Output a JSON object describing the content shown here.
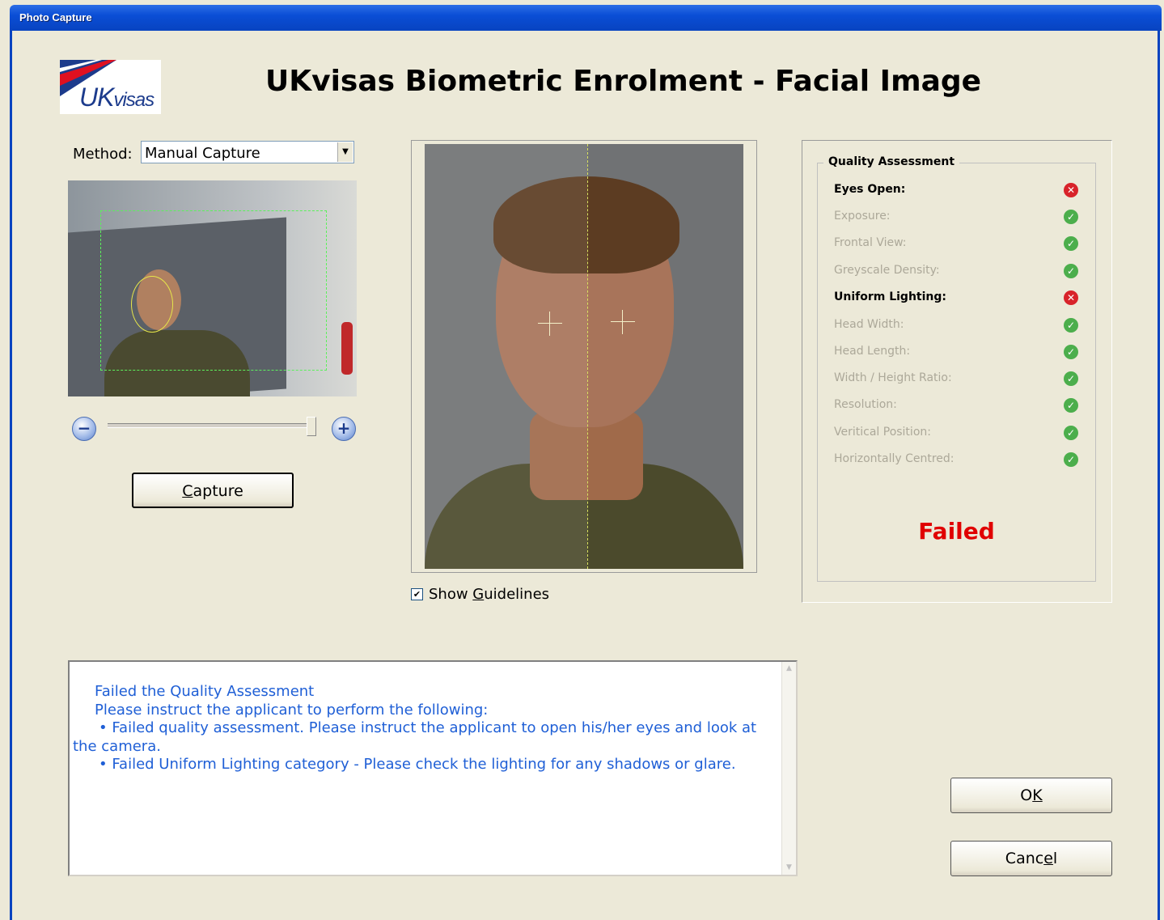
{
  "window": {
    "title": "Photo Capture"
  },
  "header": {
    "title": "UKvisas Biometric Enrolment - Facial Image",
    "logo_text_main": "UK",
    "logo_text_small": "visas"
  },
  "method": {
    "label": "Method:",
    "value": "Manual Capture"
  },
  "preview": {
    "zoom_out_icon": "minus-circle-icon",
    "zoom_in_icon": "plus-circle-icon",
    "zoom_level": 1.0
  },
  "capture_button": {
    "pre": "",
    "accel": "C",
    "post": "apture"
  },
  "guidelines": {
    "checked": true,
    "pre": "Show ",
    "accel": "G",
    "post": "uidelines"
  },
  "quality": {
    "title": "Quality Assessment",
    "rows": [
      {
        "label": "Eyes Open:",
        "status": "fail"
      },
      {
        "label": "Exposure:",
        "status": "pass"
      },
      {
        "label": "Frontal View:",
        "status": "pass"
      },
      {
        "label": "Greyscale Density:",
        "status": "pass"
      },
      {
        "label": "Uniform Lighting:",
        "status": "fail"
      },
      {
        "label": "Head Width:",
        "status": "pass"
      },
      {
        "label": "Head Length:",
        "status": "pass"
      },
      {
        "label": "Width / Height Ratio:",
        "status": "pass"
      },
      {
        "label": "Resolution:",
        "status": "pass"
      },
      {
        "label": "Veritical Position:",
        "status": "pass"
      },
      {
        "label": "Horizontally Centred:",
        "status": "pass"
      }
    ],
    "result": "Failed",
    "colors": {
      "fail": "#d8232a",
      "pass": "#4cae4c",
      "result": "#e00000"
    }
  },
  "message": {
    "line1": "Failed the Quality Assessment",
    "line2": "Please instruct the applicant to perform the following:",
    "bullet1": "•  Failed quality assessment. Please instruct the applicant to open his/her eyes and look at the camera.",
    "bullet2": "•  Failed Uniform Lighting category - Please check the lighting for any shadows or glare.",
    "color": "#1f5fd6"
  },
  "ok_button": {
    "pre": "O",
    "accel": "K",
    "post": ""
  },
  "cancel_button": {
    "pre": "Canc",
    "accel": "e",
    "post": "l"
  }
}
